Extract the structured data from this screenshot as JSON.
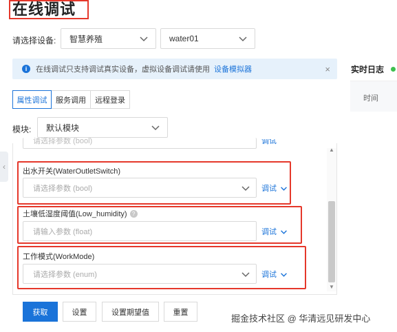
{
  "page": {
    "title": "在线调试"
  },
  "device": {
    "label": "请选择设备:",
    "product": "智慧养殖",
    "device_name": "water01"
  },
  "banner": {
    "text": "在线调试只支持调试真实设备，虚拟设备调试请使用",
    "link": "设备模拟器",
    "close": "×"
  },
  "tabs": [
    {
      "label": "属性调试",
      "active": true
    },
    {
      "label": "服务调用",
      "active": false
    },
    {
      "label": "远程登录",
      "active": false
    }
  ],
  "module": {
    "label": "模块:",
    "value": "默认模块"
  },
  "fields": {
    "partial": {
      "placeholder": "请选择参数 (bool)",
      "debug": "调试"
    },
    "items": [
      {
        "label": "出水开关(WaterOutletSwitch)",
        "placeholder": "请选择参数 (bool)",
        "debug": "调试",
        "kind": "select"
      },
      {
        "label": "土壤低湿度阈值(Low_humidity)",
        "placeholder": "请输入参数 (float)",
        "debug": "调试",
        "kind": "input",
        "help": "?"
      },
      {
        "label": "工作模式(WorkMode)",
        "placeholder": "请选择参数 (enum)",
        "debug": "调试",
        "kind": "select"
      }
    ]
  },
  "buttons": {
    "get": "获取",
    "set": "设置",
    "set_expected": "设置期望值",
    "reset": "重置"
  },
  "realtime_log": {
    "title": "实时日志",
    "column_time": "时间"
  },
  "watermark": "掘金技术社区 @ 华清远见研发中心",
  "colors": {
    "accent": "#1a73d9",
    "highlight": "#e5372a",
    "online": "#3fbf4f"
  }
}
